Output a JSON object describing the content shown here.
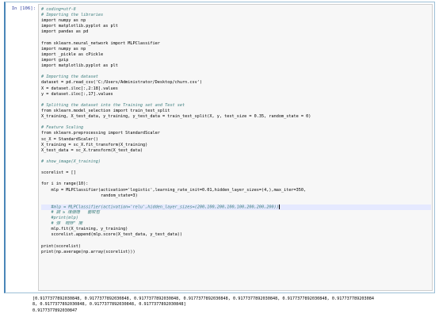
{
  "cell": {
    "prompt": "In [106]:",
    "code_lines": [
      {
        "text": "# coding=utf-8",
        "kind": "comment"
      },
      {
        "text": "# Importing the libraries",
        "kind": "comment"
      },
      {
        "text": "import numpy as np",
        "kind": "code"
      },
      {
        "text": "import matplotlib.pyplot as plt",
        "kind": "code"
      },
      {
        "text": "import pandas as pd",
        "kind": "code"
      },
      {
        "text": "",
        "kind": "blank"
      },
      {
        "text": "from sklearn.neural_network import MLPClassifier",
        "kind": "code"
      },
      {
        "text": "import numpy as np",
        "kind": "code"
      },
      {
        "text": "import _pickle as cPickle",
        "kind": "code"
      },
      {
        "text": "import gzip",
        "kind": "code"
      },
      {
        "text": "import matplotlib.pyplot as plt",
        "kind": "code"
      },
      {
        "text": "",
        "kind": "blank"
      },
      {
        "text": "# Importing the dataset",
        "kind": "comment"
      },
      {
        "text": "dataset = pd.read_csv('C:/Users/Administrator/Desktop/churn.csv')",
        "kind": "code"
      },
      {
        "text": "X = dataset.iloc[:,2:18].values",
        "kind": "code"
      },
      {
        "text": "y = dataset.iloc[:,17].values",
        "kind": "code"
      },
      {
        "text": "",
        "kind": "blank"
      },
      {
        "text": "# Splitting the dataset into the Training set and Test set",
        "kind": "comment"
      },
      {
        "text": "from sklearn.model_selection import train_test_split",
        "kind": "code"
      },
      {
        "text": "X_training, X_test_data, y_training, y_test_data = train_test_split(X, y, test_size = 0.35, random_state = 0)",
        "kind": "code"
      },
      {
        "text": "",
        "kind": "blank"
      },
      {
        "text": "# Feature Scaling",
        "kind": "comment"
      },
      {
        "text": "from sklearn.preprocessing import StandardScaler",
        "kind": "code"
      },
      {
        "text": "sc_X = StandardScaler()",
        "kind": "code"
      },
      {
        "text": "X_training = sc_X.fit_transform(X_training)",
        "kind": "code"
      },
      {
        "text": "X_test_data = sc_X.transform(X_test_data)",
        "kind": "code"
      },
      {
        "text": "",
        "kind": "blank"
      },
      {
        "text": "# show_image(X_training)",
        "kind": "comment"
      },
      {
        "text": "",
        "kind": "blank"
      },
      {
        "text": "scorelist = []",
        "kind": "code"
      },
      {
        "text": "",
        "kind": "blank"
      },
      {
        "text": "for i in range(10):",
        "kind": "code"
      },
      {
        "text": "    mlp = MLPClassifier(activation='logistic',learning_rate_init=0.01,hidden_layer_sizes=(4,),max_iter=350,",
        "kind": "code"
      },
      {
        "text": "                        random_state=3)",
        "kind": "code"
      },
      {
        "text": "",
        "kind": "blank"
      },
      {
        "text": "    #mlp = MLPClassifier(activation='relu',hidden_layer_sizes=(200,100,200,100,100,200,200,200))",
        "kind": "comment-highlight"
      },
      {
        "text": "    # 調 ≥ 境値隱   藝晙苞",
        "kind": "comment"
      },
      {
        "text": "    #print(mlp)",
        "kind": "comment"
      },
      {
        "text": "    # 弶  栂陟\" 攪",
        "kind": "comment"
      },
      {
        "text": "    mlp.fit(X_training, y_training)",
        "kind": "code"
      },
      {
        "text": "    scorelist.append(mlp.score(X_test_data, y_test_data))",
        "kind": "code"
      },
      {
        "text": "",
        "kind": "blank"
      },
      {
        "text": "print(scorelist)",
        "kind": "code"
      },
      {
        "text": "print(np.average(np.array(scorelist)))",
        "kind": "code"
      }
    ]
  },
  "output": {
    "lines": [
      "[0.9177377892030848, 0.9177377892030848, 0.9177377892030848, 0.9177377892030848, 0.9177377892030848, 0.9177377892030848, 0.917737789203084",
      "8, 0.9177377892030848, 0.9177377892030848, 0.9177377892030848]",
      "0.9177377892030847"
    ]
  }
}
